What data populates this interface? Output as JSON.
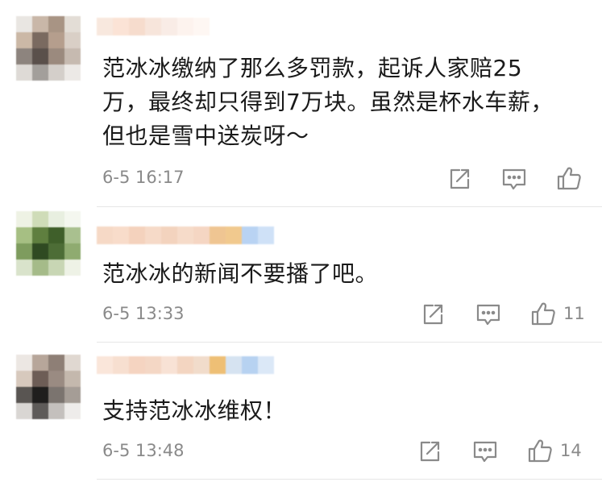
{
  "comments": [
    {
      "text": "范冰冰缴纳了那么多罚款，起诉人家赔25\n万，最终却只得到7万块。虽然是杯水车薪，\n但也是雪中送炭呀～",
      "time": "6-5 16:17",
      "likes": "",
      "avatar_colors": [
        "#e9e6e2",
        "#c9b7a8",
        "#a89484",
        "#e3ddd6",
        "#cbb8a6",
        "#7a6a60",
        "#b59e8d",
        "#d9cfc6",
        "#8d847e",
        "#5a504b",
        "#9b8a7e",
        "#c6bab0",
        "#dedad6",
        "#a39f9b",
        "#d4cfca",
        "#ece9e6"
      ],
      "name_colors": [
        "#f8e8de",
        "#fbe3d6",
        "#f6dccd",
        "#f7e5db",
        "#f9ece6",
        "#fdf3ee",
        "#fef7f3"
      ]
    },
    {
      "text": "范冰冰的新闻不要播了吧。",
      "time": "6-5 13:33",
      "likes": "11",
      "avatar_colors": [
        "#eef2e4",
        "#cfdcb8",
        "#e8efe0",
        "#f4f7ef",
        "#a6bf83",
        "#5f7f3f",
        "#3f5f2a",
        "#a9c08f",
        "#7e9c5e",
        "#2f4a22",
        "#4d6d36",
        "#8fab70",
        "#d9e3cb",
        "#a5bb89",
        "#c8d6b4",
        "#eef2e6"
      ],
      "name_colors": [
        "#f6d9c6",
        "#f8dcca",
        "#f4d2bd",
        "#f6dac8",
        "#f3d3be",
        "#f6dbc9",
        "#f5d6c3",
        "#efc592",
        "#f1c98e",
        "#b9d3f3",
        "#cfe1f7"
      ]
    },
    {
      "text": "支持范冰冰维权！",
      "time": "6-5 13:48",
      "likes": "14",
      "avatar_colors": [
        "#ece7e3",
        "#b7a69a",
        "#8e7f76",
        "#e0d8d1",
        "#d7c9bd",
        "#6d5d56",
        "#9a8b82",
        "#c4b8ad",
        "#595552",
        "#1f1e1d",
        "#7b746f",
        "#a59d96",
        "#d9d6d3",
        "#5e5b59",
        "#c4c0bd",
        "#eeecea"
      ],
      "name_colors": [
        "#fae6da",
        "#f7dfd0",
        "#f5d4c1",
        "#f4d7c5",
        "#f8e2d5",
        "#f3d5c1",
        "#f1dccb",
        "#eebf75",
        "#d6e3f1",
        "#b7d2f1",
        "#dbe8f7"
      ]
    }
  ],
  "icons": {
    "share": "share-icon",
    "reply": "comment-icon",
    "like": "thumbs-up-icon"
  }
}
